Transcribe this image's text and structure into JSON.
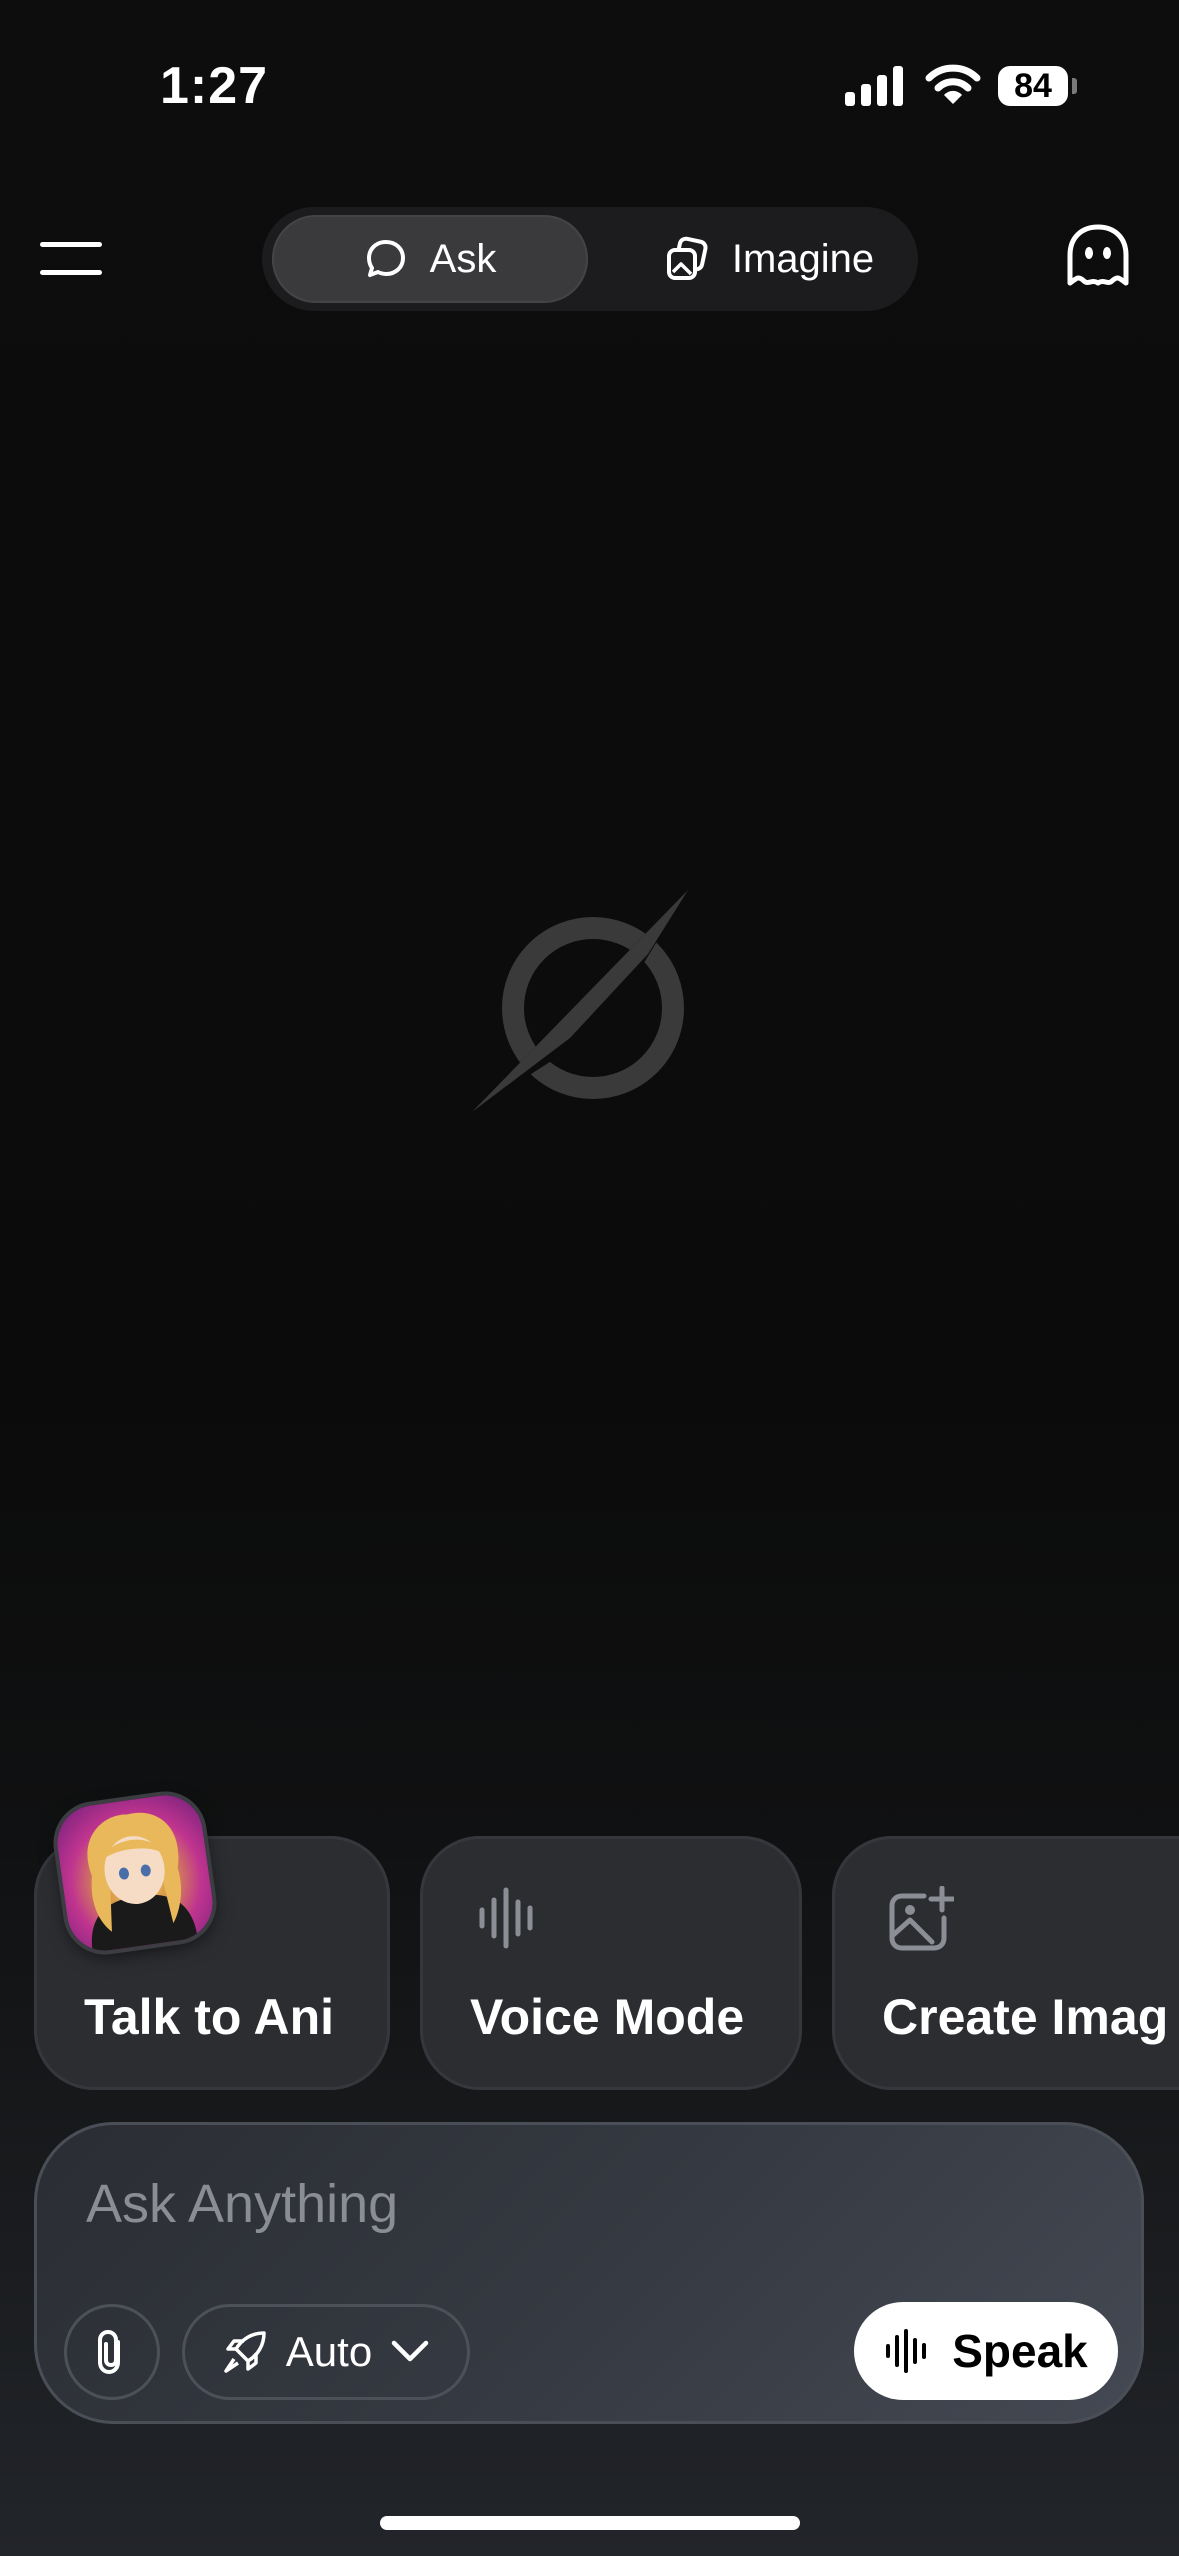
{
  "status_bar": {
    "time": "1:27",
    "battery": "84",
    "icons": [
      "signal-icon",
      "wifi-icon",
      "battery-icon"
    ]
  },
  "header": {
    "menu_icon": "hamburger-menu-icon",
    "tabs": [
      {
        "label": "Ask",
        "icon": "chat-bubble-icon",
        "selected": true
      },
      {
        "label": "Imagine",
        "icon": "image-stack-icon",
        "selected": false
      }
    ],
    "ghost_icon": "ghost-icon"
  },
  "center": {
    "logo_icon": "grok-logo-icon"
  },
  "quick_actions": [
    {
      "label": "Talk to Ani",
      "icon": "ani-avatar"
    },
    {
      "label": "Voice Mode",
      "icon": "waveform-icon"
    },
    {
      "label": "Create Imag",
      "icon": "image-plus-icon"
    }
  ],
  "composer": {
    "placeholder": "Ask Anything",
    "value": "",
    "attach_icon": "paperclip-icon",
    "model_label": "Auto",
    "model_icon": "rocket-icon",
    "speak_label": "Speak",
    "speak_icon": "waveform-icon"
  },
  "colors": {
    "background": "#0c0c0c",
    "card": "#2b2d31",
    "segment_selected": "#3a3a3c",
    "speak_button": "#ffffff"
  }
}
